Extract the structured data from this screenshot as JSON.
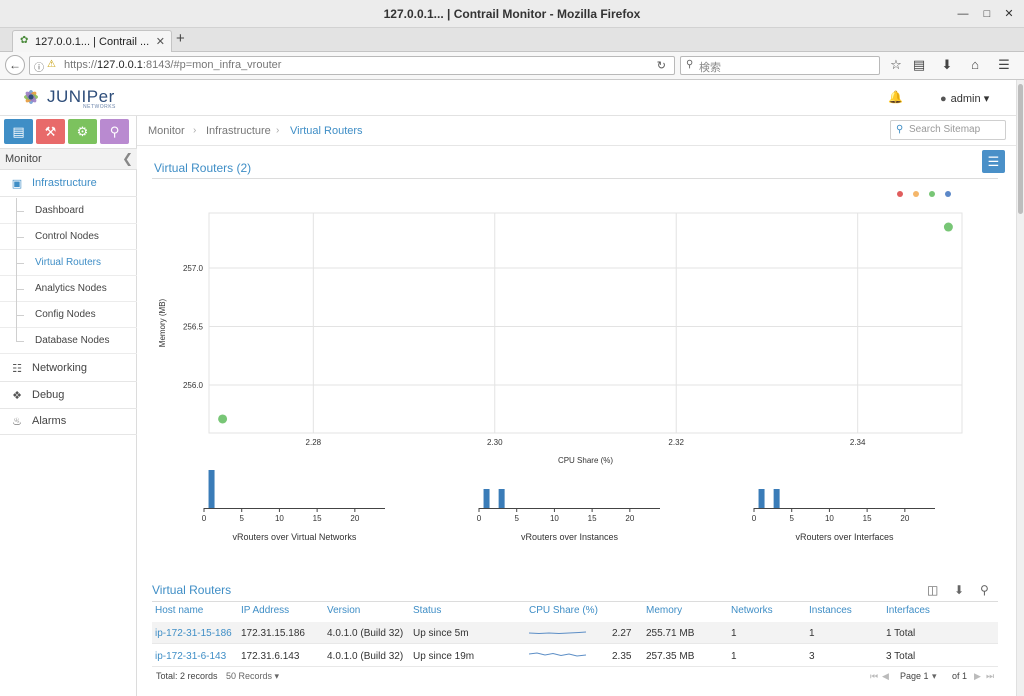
{
  "window": {
    "title": "127.0.0.1... | Contrail Monitor - Mozilla Firefox"
  },
  "browser": {
    "tab_label": "127.0.0.1... | Contrail ...",
    "url_prefix": "https://",
    "url_host": "127.0.0.1",
    "url_rest": ":8143/#p=mon_infra_vrouter",
    "search_placeholder": "検索"
  },
  "header": {
    "brand": "JUNIPer",
    "brand_sub": "NETWORKS",
    "user": "admin"
  },
  "sidebar": {
    "module_title": "Monitor",
    "sections": [
      {
        "label": "Infrastructure",
        "icon": "monitor-icon"
      },
      {
        "label": "Networking",
        "icon": "sitemap-icon"
      },
      {
        "label": "Debug",
        "icon": "puzzle-icon"
      },
      {
        "label": "Alarms",
        "icon": "bell-icon"
      }
    ],
    "infra_items": [
      "Dashboard",
      "Control Nodes",
      "Virtual Routers",
      "Analytics Nodes",
      "Config Nodes",
      "Database Nodes"
    ]
  },
  "breadcrumb": [
    "Monitor",
    "Infrastructure",
    "Virtual Routers"
  ],
  "sitemap_placeholder": "Search Sitemap",
  "section_title": "Virtual Routers (2)",
  "colors": {
    "accent": "#3f8ec6",
    "green": "#78c676",
    "red": "#e05d5d",
    "orange": "#f4b66a",
    "blue": "#5c88c8",
    "bar": "#3a7cb8"
  },
  "chart_data": [
    {
      "type": "scatter",
      "xlabel": "CPU Share (%)",
      "ylabel": "Memory (MB)",
      "xlim": [
        2.2685,
        2.3515
      ],
      "ylim": [
        255.59,
        257.47
      ],
      "xticks": [
        "2.28",
        "2.30",
        "2.32",
        "2.34"
      ],
      "yticks": [
        "256.0",
        "256.5",
        "257.0"
      ],
      "legend": "top-right",
      "points": [
        {
          "x": 2.27,
          "y": 255.71,
          "color": "#78c676"
        },
        {
          "x": 2.35,
          "y": 257.35,
          "color": "#78c676"
        }
      ]
    },
    {
      "type": "bar",
      "xlabel": "vRouters over Virtual Networks",
      "xticks": [
        "0",
        "5",
        "10",
        "15",
        "20"
      ],
      "xlim": [
        0,
        24
      ],
      "bars": [
        {
          "x": 1,
          "count": 2
        }
      ]
    },
    {
      "type": "bar",
      "xlabel": "vRouters over Instances",
      "xticks": [
        "0",
        "5",
        "10",
        "15",
        "20"
      ],
      "xlim": [
        0,
        24
      ],
      "bars": [
        {
          "x": 1,
          "count": 1
        },
        {
          "x": 3,
          "count": 1
        }
      ]
    },
    {
      "type": "bar",
      "xlabel": "vRouters over Interfaces",
      "xticks": [
        "0",
        "5",
        "10",
        "15",
        "20"
      ],
      "xlim": [
        0,
        24
      ],
      "bars": [
        {
          "x": 1,
          "count": 1
        },
        {
          "x": 3,
          "count": 1
        }
      ]
    }
  ],
  "grid": {
    "title": "Virtual Routers",
    "columns": [
      "Host name",
      "IP Address",
      "Version",
      "Status",
      "CPU Share (%)",
      "Memory",
      "Networks",
      "Instances",
      "Interfaces"
    ],
    "rows": [
      {
        "host": "ip-172-31-15-186",
        "ip": "172.31.15.186",
        "version": "4.0.1.0 (Build 32)",
        "status": "Up since 5m",
        "cpu": "2.27",
        "memory": "255.71 MB",
        "networks": "1",
        "instances": "1",
        "interfaces": "1 Total"
      },
      {
        "host": "ip-172-31-6-143",
        "ip": "172.31.6.143",
        "version": "4.0.1.0 (Build 32)",
        "status": "Up since 19m",
        "cpu": "2.35",
        "memory": "257.35 MB",
        "networks": "1",
        "instances": "3",
        "interfaces": "3 Total"
      }
    ],
    "total": "Total: 2 records",
    "page_size": "50 Records",
    "page_label": "Page 1",
    "page_of": "of 1"
  }
}
